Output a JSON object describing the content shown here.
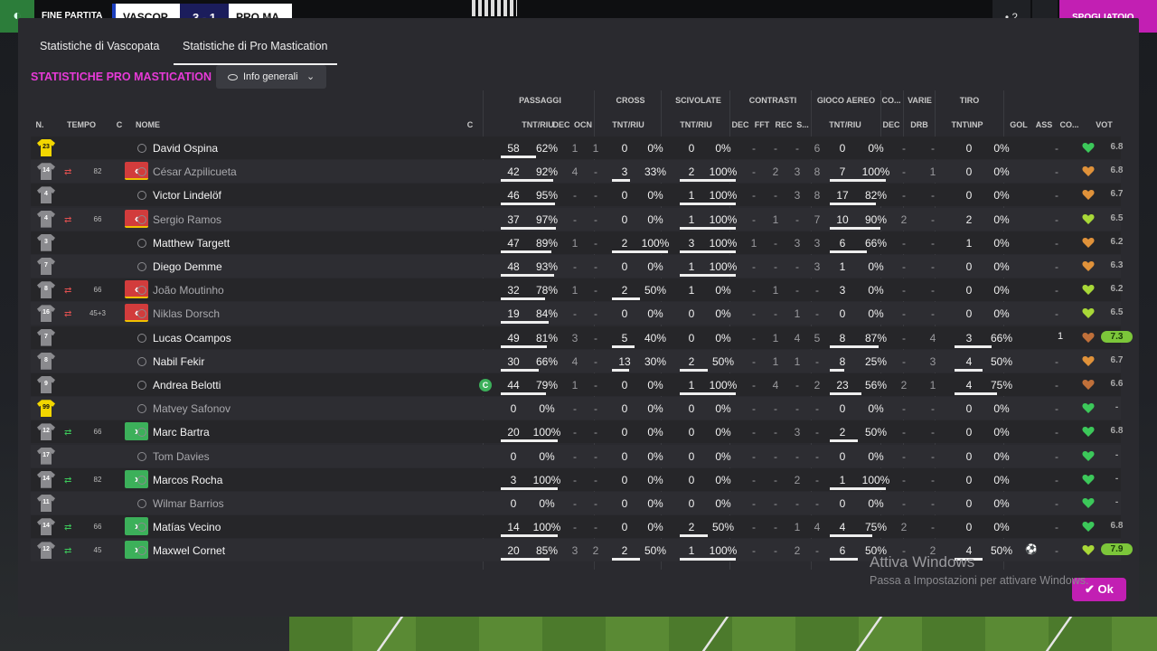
{
  "topbar": {
    "end_label": "FINE PARTITA",
    "team_a": "VASCOP",
    "score": "3 - 1",
    "team_b": "PRO MA",
    "btn_a": "• 2",
    "btn_b": "⌄",
    "btn_c": "SPOGLIATOIO"
  },
  "tabs": [
    "Statistiche di Vascopata",
    "Statistiche di Pro Mastication"
  ],
  "section_title": "STATISTICHE PRO MASTICATION",
  "dropdown": {
    "label": "Info generali",
    "eye_icon": "eye-icon",
    "chevron_icon": "chevron-down-icon"
  },
  "group_headers": {
    "passaggi": "PASSAGGI",
    "cross": "CROSS",
    "scivolate": "SCIVOLATE",
    "contrasti": "CONTRASTI",
    "gioco_aereo": "GIOCO AEREO",
    "co": "CO...",
    "varie": "VARIE",
    "tiro": "TIRO"
  },
  "columns": {
    "n": "N.",
    "tempo": "TEMPO",
    "c": "C",
    "nome": "NOME",
    "cc": "C",
    "pass": "TNT/RIU",
    "pdec": "DEC",
    "ocn": "OCN",
    "cross": "TNT/RIU",
    "scivolate": "TNT/RIU",
    "cdec": "DEC",
    "fft": "FFT",
    "rec": "REC",
    "s": "S...",
    "aereo": "TNT/RIU",
    "codec": "DEC",
    "drb": "DRB",
    "tiro": "TNT\\INP",
    "gol": "GOL",
    "ass": "ASS",
    "cond": "CO...",
    "vot": "VOT"
  },
  "rows": [
    {
      "num": "23",
      "gk": true,
      "dim": false,
      "name": "David Ospina",
      "sub": "",
      "time": "",
      "pass": "58",
      "pass_pct": "62%",
      "pass_fill": 0.62,
      "pdec": "1",
      "ocn": "1",
      "cross": "0",
      "cross_pct": "0%",
      "cross_fill": 0,
      "sciv": "0",
      "sciv_pct": "0%",
      "sciv_fill": 0,
      "cdec": "-",
      "fft": "-",
      "rec": "-",
      "s": "6",
      "aer": "0",
      "aer_pct": "0%",
      "aer_fill": 0,
      "codec": "-",
      "drb": "-",
      "tiro": "0",
      "tiro_pct": "0%",
      "tiro_fill": 0,
      "gol": "",
      "ass": "-",
      "heart": "#3cc85a",
      "vot": "6.8",
      "vot_high": false
    },
    {
      "num": "14",
      "gk": false,
      "dim": true,
      "name": "César Azpilicueta",
      "sub": "out",
      "time": "82",
      "pass": "42",
      "pass_pct": "92%",
      "pass_fill": 0.92,
      "pdec": "4",
      "ocn": "-",
      "cross": "3",
      "cross_pct": "33%",
      "cross_fill": 0.33,
      "sciv": "2",
      "sciv_pct": "100%",
      "sciv_fill": 1,
      "cdec": "-",
      "fft": "2",
      "rec": "3",
      "s": "8",
      "aer": "7",
      "aer_pct": "100%",
      "aer_fill": 1,
      "codec": "-",
      "drb": "1",
      "tiro": "0",
      "tiro_pct": "0%",
      "tiro_fill": 0,
      "gol": "",
      "ass": "-",
      "heart": "#e0923a",
      "vot": "6.8",
      "vot_high": false
    },
    {
      "num": "4",
      "gk": false,
      "dim": false,
      "name": "Victor Lindelöf",
      "sub": "",
      "time": "",
      "pass": "46",
      "pass_pct": "95%",
      "pass_fill": 0.95,
      "pdec": "-",
      "ocn": "-",
      "cross": "0",
      "cross_pct": "0%",
      "cross_fill": 0,
      "sciv": "1",
      "sciv_pct": "100%",
      "sciv_fill": 1,
      "cdec": "-",
      "fft": "-",
      "rec": "3",
      "s": "8",
      "aer": "17",
      "aer_pct": "82%",
      "aer_fill": 0.82,
      "codec": "-",
      "drb": "-",
      "tiro": "0",
      "tiro_pct": "0%",
      "tiro_fill": 0,
      "gol": "",
      "ass": "-",
      "heart": "#e0923a",
      "vot": "6.7",
      "vot_high": false
    },
    {
      "num": "4",
      "gk": false,
      "dim": true,
      "name": "Sergio Ramos",
      "sub": "out",
      "time": "66",
      "pass": "37",
      "pass_pct": "97%",
      "pass_fill": 0.97,
      "pdec": "-",
      "ocn": "-",
      "cross": "0",
      "cross_pct": "0%",
      "cross_fill": 0,
      "sciv": "1",
      "sciv_pct": "100%",
      "sciv_fill": 1,
      "cdec": "-",
      "fft": "1",
      "rec": "-",
      "s": "7",
      "aer": "10",
      "aer_pct": "90%",
      "aer_fill": 0.9,
      "codec": "2",
      "drb": "-",
      "tiro": "2",
      "tiro_pct": "0%",
      "tiro_fill": 0,
      "gol": "",
      "ass": "-",
      "heart": "#a8d838",
      "vot": "6.5",
      "vot_high": false
    },
    {
      "num": "3",
      "gk": false,
      "dim": false,
      "name": "Matthew Targett",
      "sub": "",
      "time": "",
      "pass": "47",
      "pass_pct": "89%",
      "pass_fill": 0.89,
      "pdec": "1",
      "ocn": "-",
      "cross": "2",
      "cross_pct": "100%",
      "cross_fill": 1,
      "sciv": "3",
      "sciv_pct": "100%",
      "sciv_fill": 1,
      "cdec": "1",
      "fft": "-",
      "rec": "3",
      "s": "3",
      "aer": "6",
      "aer_pct": "66%",
      "aer_fill": 0.66,
      "codec": "-",
      "drb": "-",
      "tiro": "1",
      "tiro_pct": "0%",
      "tiro_fill": 0,
      "gol": "",
      "ass": "-",
      "heart": "#e0923a",
      "vot": "6.2",
      "vot_high": false
    },
    {
      "num": "7",
      "gk": false,
      "dim": false,
      "name": "Diego Demme",
      "sub": "",
      "time": "",
      "pass": "48",
      "pass_pct": "93%",
      "pass_fill": 0.93,
      "pdec": "-",
      "ocn": "-",
      "cross": "0",
      "cross_pct": "0%",
      "cross_fill": 0,
      "sciv": "1",
      "sciv_pct": "100%",
      "sciv_fill": 1,
      "cdec": "-",
      "fft": "-",
      "rec": "-",
      "s": "3",
      "aer": "1",
      "aer_pct": "0%",
      "aer_fill": 0,
      "codec": "-",
      "drb": "-",
      "tiro": "0",
      "tiro_pct": "0%",
      "tiro_fill": 0,
      "gol": "",
      "ass": "-",
      "heart": "#e0923a",
      "vot": "6.3",
      "vot_high": false
    },
    {
      "num": "8",
      "gk": false,
      "dim": true,
      "name": "João Moutinho",
      "sub": "out",
      "time": "66",
      "pass": "32",
      "pass_pct": "78%",
      "pass_fill": 0.78,
      "pdec": "1",
      "ocn": "-",
      "cross": "2",
      "cross_pct": "50%",
      "cross_fill": 0.5,
      "sciv": "1",
      "sciv_pct": "0%",
      "sciv_fill": 0,
      "cdec": "-",
      "fft": "1",
      "rec": "-",
      "s": "-",
      "aer": "3",
      "aer_pct": "0%",
      "aer_fill": 0,
      "codec": "-",
      "drb": "-",
      "tiro": "0",
      "tiro_pct": "0%",
      "tiro_fill": 0,
      "gol": "",
      "ass": "-",
      "heart": "#a8d838",
      "vot": "6.2",
      "vot_high": false
    },
    {
      "num": "16",
      "gk": false,
      "dim": true,
      "name": "Niklas Dorsch",
      "sub": "out",
      "time": "45+3",
      "pass": "19",
      "pass_pct": "84%",
      "pass_fill": 0.84,
      "pdec": "-",
      "ocn": "-",
      "cross": "0",
      "cross_pct": "0%",
      "cross_fill": 0,
      "sciv": "0",
      "sciv_pct": "0%",
      "sciv_fill": 0,
      "cdec": "-",
      "fft": "-",
      "rec": "1",
      "s": "-",
      "aer": "0",
      "aer_pct": "0%",
      "aer_fill": 0,
      "codec": "-",
      "drb": "-",
      "tiro": "0",
      "tiro_pct": "0%",
      "tiro_fill": 0,
      "gol": "",
      "ass": "-",
      "heart": "#a8d838",
      "vot": "6.5",
      "vot_high": false
    },
    {
      "num": "7",
      "gk": false,
      "dim": false,
      "name": "Lucas Ocampos",
      "sub": "",
      "time": "",
      "pass": "49",
      "pass_pct": "81%",
      "pass_fill": 0.81,
      "pdec": "3",
      "ocn": "-",
      "cross": "5",
      "cross_pct": "40%",
      "cross_fill": 0.4,
      "sciv": "0",
      "sciv_pct": "0%",
      "sciv_fill": 0,
      "cdec": "-",
      "fft": "1",
      "rec": "4",
      "s": "5",
      "aer": "8",
      "aer_pct": "87%",
      "aer_fill": 0.87,
      "codec": "-",
      "drb": "4",
      "tiro": "3",
      "tiro_pct": "66%",
      "tiro_fill": 0.66,
      "gol": "1",
      "ass": "",
      "heart": "#c0703a",
      "vot": "7.3",
      "vot_high": true
    },
    {
      "num": "8",
      "gk": false,
      "dim": false,
      "name": "Nabil Fekir",
      "sub": "",
      "time": "",
      "pass": "30",
      "pass_pct": "66%",
      "pass_fill": 0.66,
      "pdec": "4",
      "ocn": "-",
      "cross": "13",
      "cross_pct": "30%",
      "cross_fill": 0.3,
      "sciv": "2",
      "sciv_pct": "50%",
      "sciv_fill": 0.5,
      "cdec": "-",
      "fft": "1",
      "rec": "1",
      "s": "-",
      "aer": "8",
      "aer_pct": "25%",
      "aer_fill": 0.25,
      "codec": "-",
      "drb": "3",
      "tiro": "4",
      "tiro_pct": "50%",
      "tiro_fill": 0.5,
      "gol": "",
      "ass": "-",
      "heart": "#e0923a",
      "vot": "6.7",
      "vot_high": false
    },
    {
      "num": "9",
      "gk": false,
      "dim": false,
      "name": "Andrea Belotti",
      "sub": "",
      "time": "",
      "pass": "44",
      "pass_pct": "79%",
      "pass_fill": 0.79,
      "pdec": "1",
      "ocn": "-",
      "cross": "0",
      "cross_pct": "0%",
      "cross_fill": 0,
      "sciv": "1",
      "sciv_pct": "100%",
      "sciv_fill": 1,
      "cdec": "-",
      "fft": "4",
      "rec": "-",
      "s": "2",
      "aer": "23",
      "aer_pct": "56%",
      "aer_fill": 0.56,
      "codec": "2",
      "drb": "1",
      "tiro": "4",
      "tiro_pct": "75%",
      "tiro_fill": 0.75,
      "gol": "",
      "ass": "-",
      "heart": "#c0703a",
      "vot": "6.6",
      "vot_high": false,
      "captain": "C"
    },
    {
      "num": "99",
      "gk": true,
      "dim": true,
      "name": "Matvey Safonov",
      "sub": "",
      "time": "",
      "pass": "0",
      "pass_pct": "0%",
      "pass_fill": 0,
      "pdec": "-",
      "ocn": "-",
      "cross": "0",
      "cross_pct": "0%",
      "cross_fill": 0,
      "sciv": "0",
      "sciv_pct": "0%",
      "sciv_fill": 0,
      "cdec": "-",
      "fft": "-",
      "rec": "-",
      "s": "-",
      "aer": "0",
      "aer_pct": "0%",
      "aer_fill": 0,
      "codec": "-",
      "drb": "-",
      "tiro": "0",
      "tiro_pct": "0%",
      "tiro_fill": 0,
      "gol": "",
      "ass": "-",
      "heart": "#3cc85a",
      "vot": "-",
      "vot_high": false
    },
    {
      "num": "12",
      "gk": false,
      "dim": false,
      "name": "Marc Bartra",
      "sub": "in",
      "time": "66",
      "pass": "20",
      "pass_pct": "100%",
      "pass_fill": 1,
      "pdec": "-",
      "ocn": "-",
      "cross": "0",
      "cross_pct": "0%",
      "cross_fill": 0,
      "sciv": "0",
      "sciv_pct": "0%",
      "sciv_fill": 0,
      "cdec": "-",
      "fft": "-",
      "rec": "3",
      "s": "-",
      "aer": "2",
      "aer_pct": "50%",
      "aer_fill": 0.5,
      "codec": "-",
      "drb": "-",
      "tiro": "0",
      "tiro_pct": "0%",
      "tiro_fill": 0,
      "gol": "",
      "ass": "-",
      "heart": "#3cc85a",
      "vot": "6.8",
      "vot_high": false
    },
    {
      "num": "17",
      "gk": false,
      "dim": true,
      "name": "Tom Davies",
      "sub": "",
      "time": "",
      "pass": "0",
      "pass_pct": "0%",
      "pass_fill": 0,
      "pdec": "-",
      "ocn": "-",
      "cross": "0",
      "cross_pct": "0%",
      "cross_fill": 0,
      "sciv": "0",
      "sciv_pct": "0%",
      "sciv_fill": 0,
      "cdec": "-",
      "fft": "-",
      "rec": "-",
      "s": "-",
      "aer": "0",
      "aer_pct": "0%",
      "aer_fill": 0,
      "codec": "-",
      "drb": "-",
      "tiro": "0",
      "tiro_pct": "0%",
      "tiro_fill": 0,
      "gol": "",
      "ass": "-",
      "heart": "#3cc85a",
      "vot": "-",
      "vot_high": false
    },
    {
      "num": "14",
      "gk": false,
      "dim": false,
      "name": "Marcos Rocha",
      "sub": "in",
      "time": "82",
      "pass": "3",
      "pass_pct": "100%",
      "pass_fill": 1,
      "pdec": "-",
      "ocn": "-",
      "cross": "0",
      "cross_pct": "0%",
      "cross_fill": 0,
      "sciv": "0",
      "sciv_pct": "0%",
      "sciv_fill": 0,
      "cdec": "-",
      "fft": "-",
      "rec": "2",
      "s": "-",
      "aer": "1",
      "aer_pct": "100%",
      "aer_fill": 1,
      "codec": "-",
      "drb": "-",
      "tiro": "0",
      "tiro_pct": "0%",
      "tiro_fill": 0,
      "gol": "",
      "ass": "-",
      "heart": "#3cc85a",
      "vot": "-",
      "vot_high": false
    },
    {
      "num": "11",
      "gk": false,
      "dim": true,
      "name": "Wilmar Barrios",
      "sub": "",
      "time": "",
      "pass": "0",
      "pass_pct": "0%",
      "pass_fill": 0,
      "pdec": "-",
      "ocn": "-",
      "cross": "0",
      "cross_pct": "0%",
      "cross_fill": 0,
      "sciv": "0",
      "sciv_pct": "0%",
      "sciv_fill": 0,
      "cdec": "-",
      "fft": "-",
      "rec": "-",
      "s": "-",
      "aer": "0",
      "aer_pct": "0%",
      "aer_fill": 0,
      "codec": "-",
      "drb": "-",
      "tiro": "0",
      "tiro_pct": "0%",
      "tiro_fill": 0,
      "gol": "",
      "ass": "-",
      "heart": "#3cc85a",
      "vot": "-",
      "vot_high": false
    },
    {
      "num": "14",
      "gk": false,
      "dim": false,
      "name": "Matías Vecino",
      "sub": "in",
      "time": "66",
      "pass": "14",
      "pass_pct": "100%",
      "pass_fill": 1,
      "pdec": "-",
      "ocn": "-",
      "cross": "0",
      "cross_pct": "0%",
      "cross_fill": 0,
      "sciv": "2",
      "sciv_pct": "50%",
      "sciv_fill": 0.5,
      "cdec": "-",
      "fft": "-",
      "rec": "1",
      "s": "4",
      "aer": "4",
      "aer_pct": "75%",
      "aer_fill": 0.75,
      "codec": "2",
      "drb": "-",
      "tiro": "0",
      "tiro_pct": "0%",
      "tiro_fill": 0,
      "gol": "",
      "ass": "-",
      "heart": "#3cc85a",
      "vot": "6.8",
      "vot_high": false
    },
    {
      "num": "12",
      "gk": false,
      "dim": false,
      "name": "Maxwel Cornet",
      "sub": "in",
      "time": "45",
      "pass": "20",
      "pass_pct": "85%",
      "pass_fill": 0.85,
      "pdec": "3",
      "ocn": "2",
      "cross": "2",
      "cross_pct": "50%",
      "cross_fill": 0.5,
      "sciv": "1",
      "sciv_pct": "100%",
      "sciv_fill": 1,
      "cdec": "-",
      "fft": "-",
      "rec": "2",
      "s": "-",
      "aer": "6",
      "aer_pct": "50%",
      "aer_fill": 0.5,
      "codec": "-",
      "drb": "2",
      "tiro": "4",
      "tiro_pct": "50%",
      "tiro_fill": 0.5,
      "gol": "⚽",
      "ass": "-",
      "heart": "#a8d838",
      "vot": "7.9",
      "vot_high": true
    }
  ],
  "ok_label": "Ok",
  "watermark": {
    "line1": "Attiva Windows",
    "line2": "Passa a Impostazioni per attivare Windows."
  }
}
